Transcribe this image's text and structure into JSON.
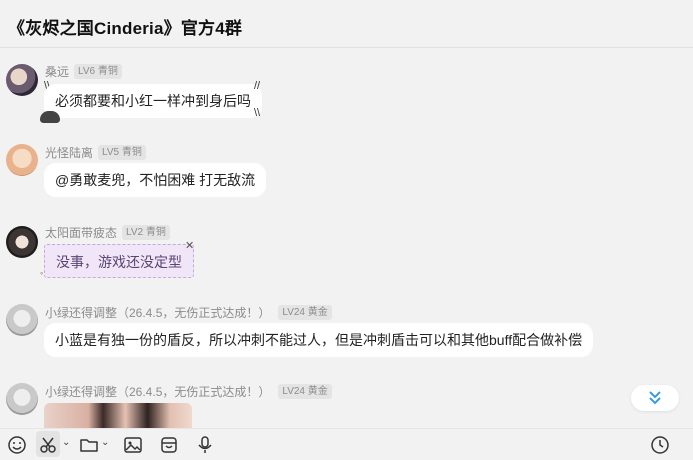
{
  "header": {
    "title": "《灰烬之国Cinderia》官方4群"
  },
  "messages": [
    {
      "name": "桑远",
      "badge": "LV6 青铜",
      "text": "必须都要和小红一样冲到身后吗",
      "style": "plain"
    },
    {
      "name": "光怪陆离",
      "badge": "LV5 青铜",
      "text": "@勇敢麦兜，不怕困难 打无敌流",
      "style": "plain"
    },
    {
      "name": "太阳面带疲态",
      "badge": "LV2 青铜",
      "text": "没事，游戏还没定型",
      "style": "purple"
    },
    {
      "name": "小绿还得调整（26.4.5，无伤正式达成！）",
      "badge": "LV24 黄金",
      "text": "小蓝是有独一份的盾反，所以冲刺不能过人，但是冲刺盾击可以和其他buff配合做补偿",
      "style": "plain"
    },
    {
      "name": "小绿还得调整（26.4.5，无伤正式达成！）",
      "badge": "LV24 黄金",
      "text": "",
      "style": "image"
    }
  ],
  "toolbar": {
    "icons": [
      "emoji-icon",
      "scissors-icon",
      "folder-icon",
      "image-icon",
      "package-icon",
      "microphone-icon",
      "history-clock-icon"
    ]
  },
  "scroll_to_bottom": {
    "icon": "double-chevron-down-icon"
  }
}
